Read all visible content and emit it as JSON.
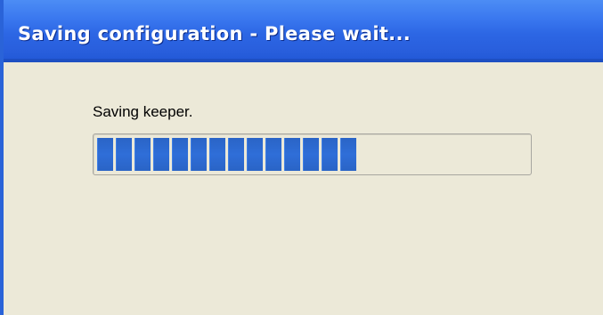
{
  "window": {
    "title": "Saving configuration - Please wait..."
  },
  "content": {
    "status_text": "Saving keeper."
  },
  "progress": {
    "fraction": 0.63,
    "color": "#2f6ed8"
  },
  "colors": {
    "title_bar": "#2c66e4",
    "window_background": "#ece9d8"
  }
}
